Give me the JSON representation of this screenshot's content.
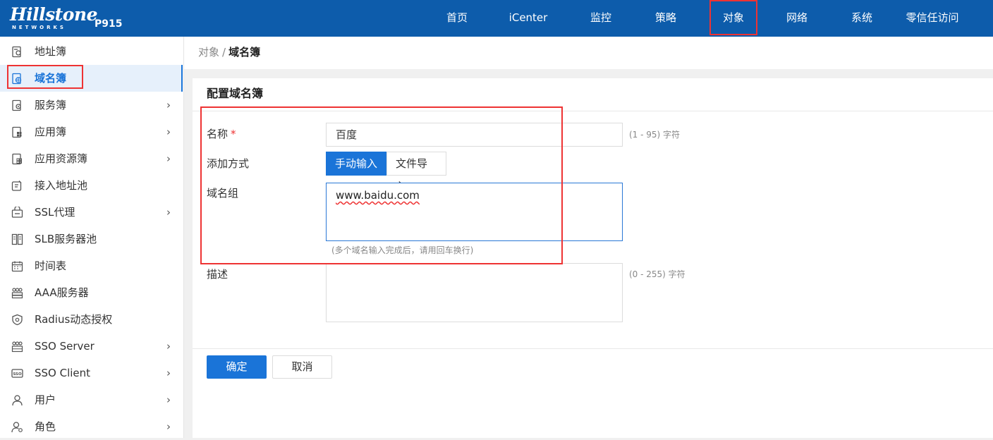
{
  "header": {
    "logo_text": "Hillstone",
    "logo_subtext": "NETWORKS",
    "model": "P915",
    "nav": [
      {
        "label": "首页"
      },
      {
        "label": "iCenter"
      },
      {
        "label": "监控"
      },
      {
        "label": "策略"
      },
      {
        "label": "对象",
        "active": true
      },
      {
        "label": "网络"
      },
      {
        "label": "系统"
      },
      {
        "label": "零信任访问"
      }
    ]
  },
  "sidebar": {
    "items": [
      {
        "label": "地址簿",
        "icon": "address-book-icon",
        "chevron": ""
      },
      {
        "label": "域名簿",
        "icon": "domain-book-icon",
        "chevron": "",
        "active": true
      },
      {
        "label": "服务簿",
        "icon": "service-book-icon",
        "chevron": "›"
      },
      {
        "label": "应用簿",
        "icon": "app-book-icon",
        "chevron": "›"
      },
      {
        "label": "应用资源簿",
        "icon": "app-resource-icon",
        "chevron": "›"
      },
      {
        "label": "接入地址池",
        "icon": "access-pool-icon",
        "chevron": ""
      },
      {
        "label": "SSL代理",
        "icon": "ssl-proxy-icon",
        "chevron": "›"
      },
      {
        "label": "SLB服务器池",
        "icon": "slb-pool-icon",
        "chevron": ""
      },
      {
        "label": "时间表",
        "icon": "calendar-icon",
        "chevron": ""
      },
      {
        "label": "AAA服务器",
        "icon": "aaa-server-icon",
        "chevron": ""
      },
      {
        "label": "Radius动态授权",
        "icon": "shield-icon",
        "chevron": ""
      },
      {
        "label": "SSO Server",
        "icon": "sso-server-icon",
        "chevron": "›"
      },
      {
        "label": "SSO Client",
        "icon": "sso-client-icon",
        "chevron": "›"
      },
      {
        "label": "用户",
        "icon": "user-icon",
        "chevron": "›"
      },
      {
        "label": "角色",
        "icon": "role-icon",
        "chevron": "›"
      }
    ]
  },
  "breadcrumb": {
    "parent": "对象",
    "separator": "/",
    "current": "域名簿"
  },
  "form": {
    "title": "配置域名簿",
    "name_label": "名称",
    "required_mark": "*",
    "name_value": "百度",
    "name_hint": "(1 - 95) 字符",
    "add_method_label": "添加方式",
    "add_manual": "手动输入",
    "add_file": "文件导入",
    "domain_group_label": "域名组",
    "domain_group_value": "www.baidu.com",
    "domain_group_hint": "(多个域名输入完成后，请用回车换行)",
    "description_label": "描述",
    "description_value": "",
    "description_hint": "(0 - 255) 字符",
    "ok_button": "确定",
    "cancel_button": "取消"
  },
  "colors": {
    "header_bg": "#0d5cab",
    "accent": "#1a74d8",
    "highlight": "#e33333"
  }
}
